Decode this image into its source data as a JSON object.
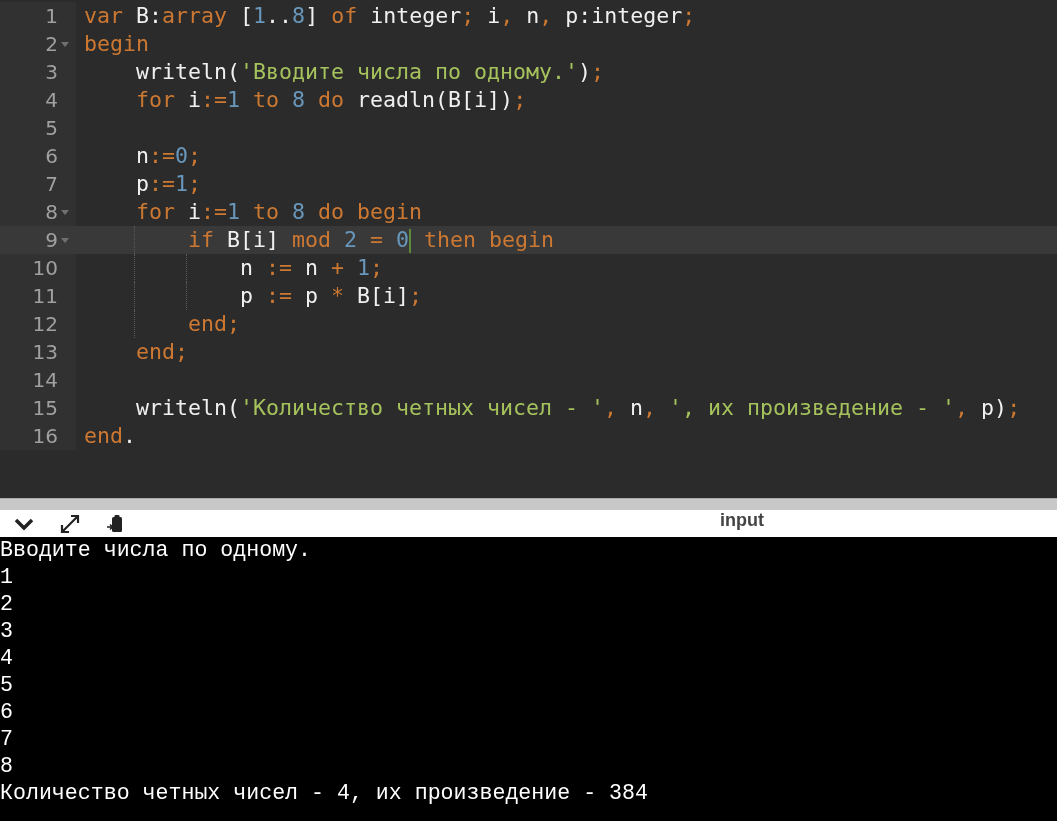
{
  "editor": {
    "lines": [
      {
        "number": "1",
        "fold": false,
        "active": false,
        "tokens": [
          {
            "text": "var",
            "kind": "keyword"
          },
          {
            "text": " B",
            "kind": "ident"
          },
          {
            "text": ":",
            "kind": "ident"
          },
          {
            "text": "array",
            "kind": "keyword"
          },
          {
            "text": " [",
            "kind": "ident"
          },
          {
            "text": "1",
            "kind": "number"
          },
          {
            "text": "..",
            "kind": "ident"
          },
          {
            "text": "8",
            "kind": "number"
          },
          {
            "text": "]",
            "kind": "ident"
          },
          {
            "text": " of",
            "kind": "keyword"
          },
          {
            "text": " integer",
            "kind": "ident"
          },
          {
            "text": ";",
            "kind": "operator"
          },
          {
            "text": " i",
            "kind": "ident"
          },
          {
            "text": ",",
            "kind": "operator"
          },
          {
            "text": " n",
            "kind": "ident"
          },
          {
            "text": ",",
            "kind": "operator"
          },
          {
            "text": " p:integer",
            "kind": "ident"
          },
          {
            "text": ";",
            "kind": "operator"
          }
        ]
      },
      {
        "number": "2",
        "fold": true,
        "active": false,
        "tokens": [
          {
            "text": "begin",
            "kind": "keyword"
          }
        ]
      },
      {
        "number": "3",
        "fold": false,
        "active": false,
        "tokens": [
          {
            "text": "    writeln(",
            "kind": "ident"
          },
          {
            "text": "'Вводите числа по одному.'",
            "kind": "string"
          },
          {
            "text": ")",
            "kind": "ident"
          },
          {
            "text": ";",
            "kind": "operator"
          }
        ]
      },
      {
        "number": "4",
        "fold": false,
        "active": false,
        "tokens": [
          {
            "text": "    for",
            "kind": "keyword"
          },
          {
            "text": " i",
            "kind": "ident"
          },
          {
            "text": ":=",
            "kind": "operator"
          },
          {
            "text": "1",
            "kind": "number"
          },
          {
            "text": " to",
            "kind": "keyword"
          },
          {
            "text": " 8",
            "kind": "number"
          },
          {
            "text": " do",
            "kind": "keyword"
          },
          {
            "text": " readln(B[i])",
            "kind": "ident"
          },
          {
            "text": ";",
            "kind": "operator"
          }
        ]
      },
      {
        "number": "5",
        "fold": false,
        "active": false
      },
      {
        "number": "6",
        "fold": false,
        "active": false,
        "tokens": [
          {
            "text": "    n",
            "kind": "ident"
          },
          {
            "text": ":=",
            "kind": "operator"
          },
          {
            "text": "0",
            "kind": "number"
          },
          {
            "text": ";",
            "kind": "operator"
          }
        ]
      },
      {
        "number": "7",
        "fold": false,
        "active": false,
        "tokens": [
          {
            "text": "    p",
            "kind": "ident"
          },
          {
            "text": ":=",
            "kind": "operator"
          },
          {
            "text": "1",
            "kind": "number"
          },
          {
            "text": ";",
            "kind": "operator"
          }
        ]
      },
      {
        "number": "8",
        "fold": true,
        "active": false,
        "tokens": [
          {
            "text": "    for",
            "kind": "keyword"
          },
          {
            "text": " i",
            "kind": "ident"
          },
          {
            "text": ":=",
            "kind": "operator"
          },
          {
            "text": "1",
            "kind": "number"
          },
          {
            "text": " to",
            "kind": "keyword"
          },
          {
            "text": " 8",
            "kind": "number"
          },
          {
            "text": " do begin",
            "kind": "keyword"
          }
        ]
      },
      {
        "number": "9",
        "fold": true,
        "active": true,
        "tokens": [
          {
            "text": "        if",
            "kind": "keyword"
          },
          {
            "text": " B[i]",
            "kind": "ident"
          },
          {
            "text": " mod",
            "kind": "keyword"
          },
          {
            "text": " 2",
            "kind": "number"
          },
          {
            "text": " =",
            "kind": "operator"
          },
          {
            "text": " 0",
            "kind": "number",
            "cursor": true
          },
          {
            "text": " then begin",
            "kind": "keyword"
          }
        ]
      },
      {
        "number": "10",
        "fold": false,
        "active": false,
        "tokens": [
          {
            "text": "            n",
            "kind": "ident"
          },
          {
            "text": " :=",
            "kind": "operator"
          },
          {
            "text": " n",
            "kind": "ident"
          },
          {
            "text": " +",
            "kind": "operator"
          },
          {
            "text": " 1",
            "kind": "number"
          },
          {
            "text": ";",
            "kind": "operator"
          }
        ]
      },
      {
        "number": "11",
        "fold": false,
        "active": false,
        "tokens": [
          {
            "text": "            p",
            "kind": "ident"
          },
          {
            "text": " :=",
            "kind": "operator"
          },
          {
            "text": " p",
            "kind": "ident"
          },
          {
            "text": " *",
            "kind": "operator"
          },
          {
            "text": " B[i]",
            "kind": "ident"
          },
          {
            "text": ";",
            "kind": "operator"
          }
        ]
      },
      {
        "number": "12",
        "fold": false,
        "active": false,
        "tokens": [
          {
            "text": "        end",
            "kind": "keyword"
          },
          {
            "text": ";",
            "kind": "operator"
          }
        ]
      },
      {
        "number": "13",
        "fold": false,
        "active": false,
        "tokens": [
          {
            "text": "    end",
            "kind": "keyword"
          },
          {
            "text": ";",
            "kind": "operator"
          }
        ]
      },
      {
        "number": "14",
        "fold": false,
        "active": false
      },
      {
        "number": "15",
        "fold": false,
        "active": false,
        "tokens": [
          {
            "text": "    writeln(",
            "kind": "ident"
          },
          {
            "text": "'Количество четных чисел - '",
            "kind": "string"
          },
          {
            "text": ",",
            "kind": "operator"
          },
          {
            "text": " n",
            "kind": "ident"
          },
          {
            "text": ",",
            "kind": "operator"
          },
          {
            "text": " ', их произведение - '",
            "kind": "string"
          },
          {
            "text": ",",
            "kind": "operator"
          },
          {
            "text": " p)",
            "kind": "ident"
          },
          {
            "text": ";",
            "kind": "operator"
          }
        ]
      },
      {
        "number": "16",
        "fold": false,
        "active": false,
        "tokens": [
          {
            "text": "end",
            "kind": "keyword"
          },
          {
            "text": ".",
            "kind": "ident"
          }
        ]
      }
    ]
  },
  "console": {
    "label": "input",
    "lines": [
      "Вводите числа по одному.",
      "1",
      "2",
      "3",
      "4",
      "5",
      "6",
      "7",
      "8",
      "Количество четных чисел - 4, их произведение - 384"
    ]
  }
}
